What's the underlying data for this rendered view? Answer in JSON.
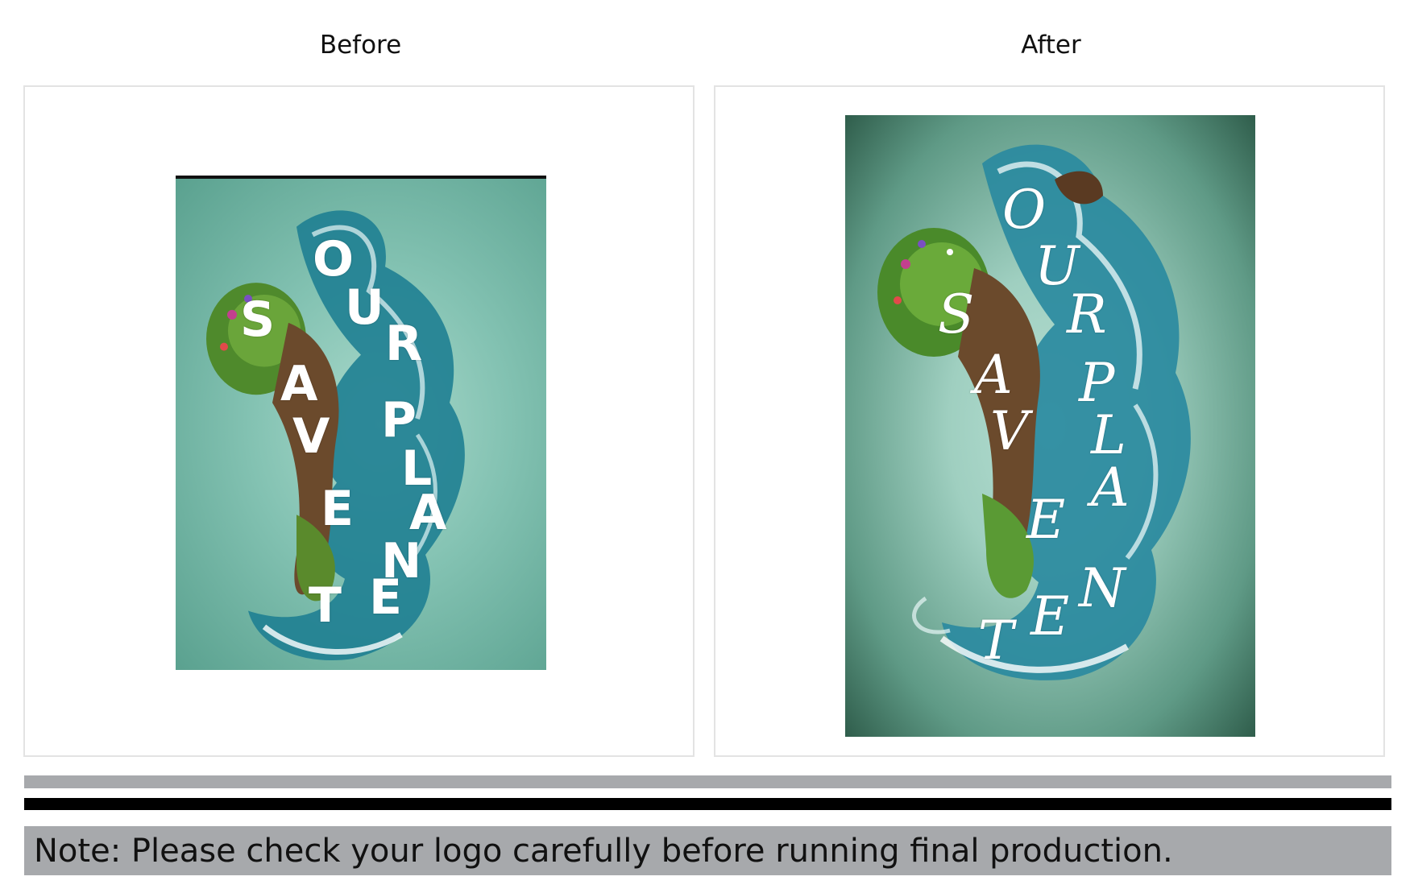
{
  "headings": {
    "before": "Before",
    "after": "After"
  },
  "before_artwork": {
    "letters": [
      "O",
      "U",
      "R",
      "P",
      "L",
      "A",
      "N",
      "E",
      "T",
      "S",
      "A",
      "V",
      "E"
    ],
    "palette": {
      "background": "#83c2b2",
      "water": "#1f7f92",
      "foliage": "#4f8a2c",
      "skin": "#6b4a2c"
    }
  },
  "after_artwork": {
    "letters": [
      "O",
      "U",
      "R",
      "P",
      "L",
      "A",
      "N",
      "E",
      "T",
      "S",
      "A",
      "V",
      "E"
    ],
    "palette": {
      "background": "#9fcfc0",
      "edge": "#2f5d4b",
      "water": "#2a8aa0",
      "foliage": "#5a9a34",
      "skin": "#6b4a2c"
    }
  },
  "note": {
    "text": "Note: Please check your logo carefully before running final production."
  },
  "colors": {
    "panel_border": "#e3e3e3",
    "grey_bar": "#a7a9ac",
    "black_bar": "#000000"
  }
}
